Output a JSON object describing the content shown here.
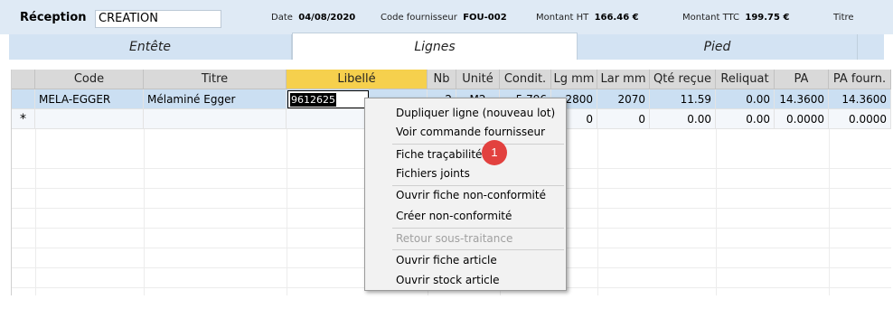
{
  "header": {
    "reception_label": "Réception",
    "reception_value": "CREATION",
    "date_label": "Date",
    "date_value": "04/08/2020",
    "supplier_label": "Code fournisseur",
    "supplier_value": "FOU-002",
    "amount_ht_label": "Montant HT",
    "amount_ht_value": "166.46 €",
    "amount_ttc_label": "Montant TTC",
    "amount_ttc_value": "199.75 €",
    "titre_label": "Titre"
  },
  "tabs": [
    {
      "label": "Entête"
    },
    {
      "label": "Lignes"
    },
    {
      "label": "Pied"
    }
  ],
  "grid": {
    "columns": [
      "Code",
      "Titre",
      "Libellé",
      "Nb",
      "Unité",
      "Condit.",
      "Lg mm",
      "Lar mm",
      "Qté reçue",
      "Reliquat",
      "PA",
      "PA fourn."
    ],
    "rows": [
      {
        "code": "MELA-EGGER",
        "titre": "Mélaminé Egger",
        "libelle": "9612625",
        "nb": "2",
        "unite": "M2",
        "condit": "5.796",
        "lg": "2800",
        "lar": "2070",
        "qte": "11.59",
        "reliquat": "0.00",
        "pa": "14.3600",
        "pa_fourn": "14.3600"
      },
      {
        "marker": "*",
        "lg": "0",
        "lar": "0",
        "qte": "0.00",
        "reliquat": "0.00",
        "pa": "0.0000",
        "pa_fourn": "0.0000"
      }
    ]
  },
  "context_menu": {
    "items": [
      {
        "label": "Dupliquer ligne (nouveau lot)"
      },
      {
        "label": "Voir commande fournisseur"
      },
      {
        "label": "Fiche traçabilité"
      },
      {
        "label": "Fichiers joints"
      },
      {
        "label": "Ouvrir fiche non-conformité"
      },
      {
        "label": "Créer non-conformité"
      },
      {
        "label": "Retour sous-traitance"
      },
      {
        "label": "Ouvrir fiche article"
      },
      {
        "label": "Ouvrir stock article"
      }
    ]
  },
  "annotation": {
    "number": "1",
    "color": "#e2413f"
  },
  "colors": {
    "accent_header": "#f6d04d",
    "selected_row": "#cbdff2",
    "topbar": "#dfeaf5"
  }
}
